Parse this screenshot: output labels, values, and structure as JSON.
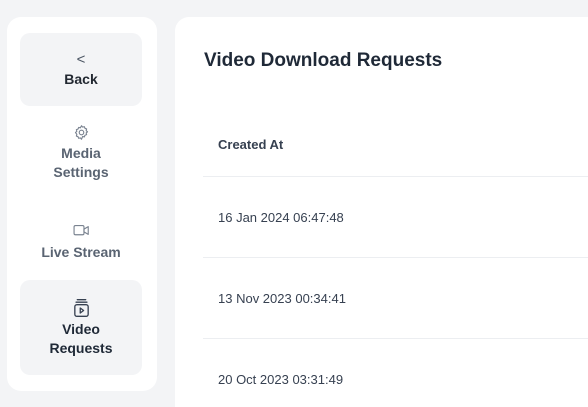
{
  "sidebar": {
    "back": {
      "icon": "chevron-left-icon",
      "glyph": "<",
      "label": "Back"
    },
    "media": {
      "icon": "gear-icon",
      "label": "Media Settings"
    },
    "live": {
      "icon": "video-camera-icon",
      "label": "Live Stream"
    },
    "video": {
      "icon": "video-library-icon",
      "label": "Video Requests"
    }
  },
  "main": {
    "title": "Video Download Requests",
    "table": {
      "header": "Created At",
      "rows": [
        "16 Jan 2024 06:47:48",
        "13 Nov 2023 00:34:41",
        "20 Oct 2023 03:31:49"
      ]
    }
  },
  "colors": {
    "background": "#f3f4f6",
    "panel": "#ffffff",
    "active_item": "#f3f4f6",
    "text_primary": "#1f2937",
    "text_muted": "#5a6472"
  }
}
